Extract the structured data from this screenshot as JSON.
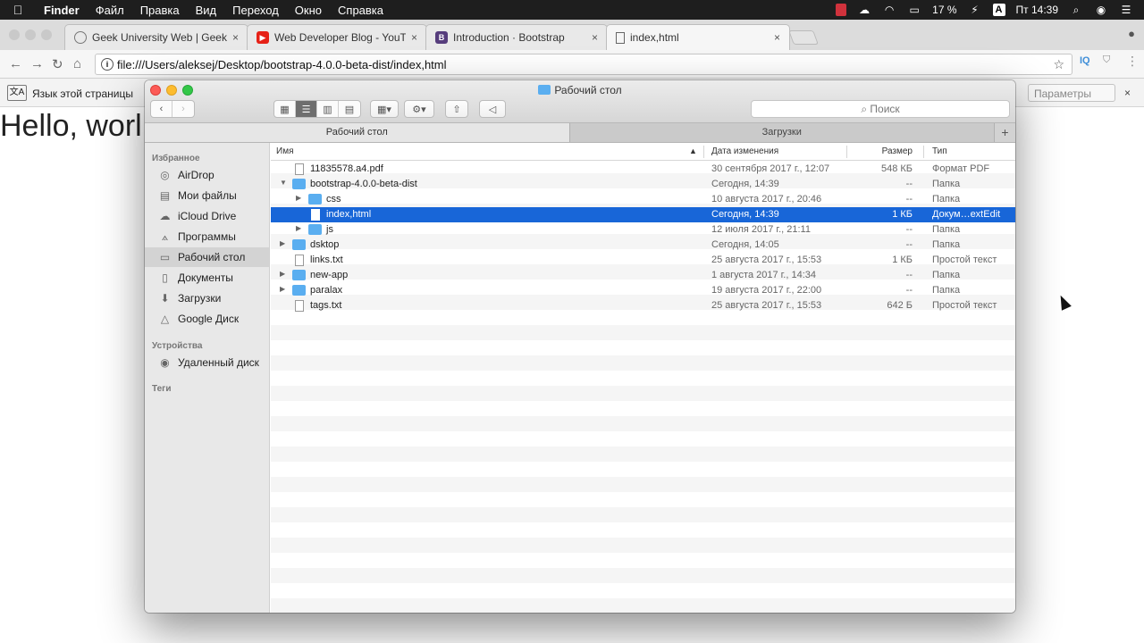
{
  "menubar": {
    "apple": "",
    "items": [
      "Finder",
      "Файл",
      "Правка",
      "Вид",
      "Переход",
      "Окно",
      "Справка"
    ],
    "battery": "17 %",
    "clock": "Пт 14:39",
    "input_source": "A"
  },
  "browser": {
    "tabs": [
      {
        "title": "Geek University Web | GeekBr",
        "favicon": "G",
        "close": "×"
      },
      {
        "title": "Web Developer Blog - YouTube",
        "favicon": "▶",
        "close": "×"
      },
      {
        "title": "Introduction · Bootstrap",
        "favicon": "B",
        "close": "×"
      },
      {
        "title": "index,html",
        "favicon": "",
        "close": "×"
      }
    ],
    "url": "file:///Users/aleksej/Desktop/bootstrap-4.0.0-beta-dist/index,html",
    "extension_label": "IQ"
  },
  "translate_bar": {
    "label": "Язык этой страницы",
    "params_label": "Параметры",
    "close": "×"
  },
  "page": {
    "heading": "Hello, worl"
  },
  "finder": {
    "title": "Рабочий стол",
    "search_placeholder": "Поиск",
    "path_tabs": [
      "Рабочий стол",
      "Загрузки"
    ],
    "add_tab": "+",
    "sidebar": {
      "favorites_header": "Избранное",
      "favorites": [
        {
          "label": "AirDrop",
          "icon": "airdrop-icon"
        },
        {
          "label": "Мои файлы",
          "icon": "all-files-icon"
        },
        {
          "label": "iCloud Drive",
          "icon": "cloud-icon"
        },
        {
          "label": "Программы",
          "icon": "applications-icon"
        },
        {
          "label": "Рабочий стол",
          "icon": "desktop-icon"
        },
        {
          "label": "Документы",
          "icon": "documents-icon"
        },
        {
          "label": "Загрузки",
          "icon": "downloads-icon"
        },
        {
          "label": "Google Диск",
          "icon": "google-drive-icon"
        }
      ],
      "devices_header": "Устройства",
      "devices": [
        {
          "label": "Удаленный диск",
          "icon": "disc-icon"
        }
      ],
      "tags_header": "Теги"
    },
    "columns": {
      "name": "Имя",
      "date": "Дата изменения",
      "size": "Размер",
      "kind": "Тип"
    },
    "rows": [
      {
        "name": "11835578.a4.pdf",
        "date": "30 сентября 2017 г., 12:07",
        "size": "548 КБ",
        "kind": "Формат PDF",
        "indent": 0,
        "type": "file",
        "arrow": "",
        "selected": false
      },
      {
        "name": "bootstrap-4.0.0-beta-dist",
        "date": "Сегодня, 14:39",
        "size": "--",
        "kind": "Папка",
        "indent": 0,
        "type": "folder",
        "arrow": "▼",
        "selected": false
      },
      {
        "name": "css",
        "date": "10 августа 2017 г., 20:46",
        "size": "--",
        "kind": "Папка",
        "indent": 1,
        "type": "folder",
        "arrow": "▶",
        "selected": false
      },
      {
        "name": "index,html",
        "date": "Сегодня, 14:39",
        "size": "1 КБ",
        "kind": "Докум…extEdit",
        "indent": 1,
        "type": "file",
        "arrow": "",
        "selected": true
      },
      {
        "name": "js",
        "date": "12 июля 2017 г., 21:11",
        "size": "--",
        "kind": "Папка",
        "indent": 1,
        "type": "folder",
        "arrow": "▶",
        "selected": false
      },
      {
        "name": "dsktop",
        "date": "Сегодня, 14:05",
        "size": "--",
        "kind": "Папка",
        "indent": 0,
        "type": "folder",
        "arrow": "▶",
        "selected": false
      },
      {
        "name": "links.txt",
        "date": "25 августа 2017 г., 15:53",
        "size": "1 КБ",
        "kind": "Простой текст",
        "indent": 0,
        "type": "file",
        "arrow": "",
        "selected": false
      },
      {
        "name": "new-app",
        "date": "1 августа 2017 г., 14:34",
        "size": "--",
        "kind": "Папка",
        "indent": 0,
        "type": "folder",
        "arrow": "▶",
        "selected": false
      },
      {
        "name": "paralax",
        "date": "19 августа 2017 г., 22:00",
        "size": "--",
        "kind": "Папка",
        "indent": 0,
        "type": "folder",
        "arrow": "▶",
        "selected": false
      },
      {
        "name": "tags.txt",
        "date": "25 августа 2017 г., 15:53",
        "size": "642 Б",
        "kind": "Простой текст",
        "indent": 0,
        "type": "file",
        "arrow": "",
        "selected": false
      }
    ]
  },
  "colors": {
    "selection": "#1866d8",
    "folder": "#5aaef0",
    "close": "#fc5b57",
    "minimize": "#fdbc2e",
    "zoom": "#33c748"
  }
}
